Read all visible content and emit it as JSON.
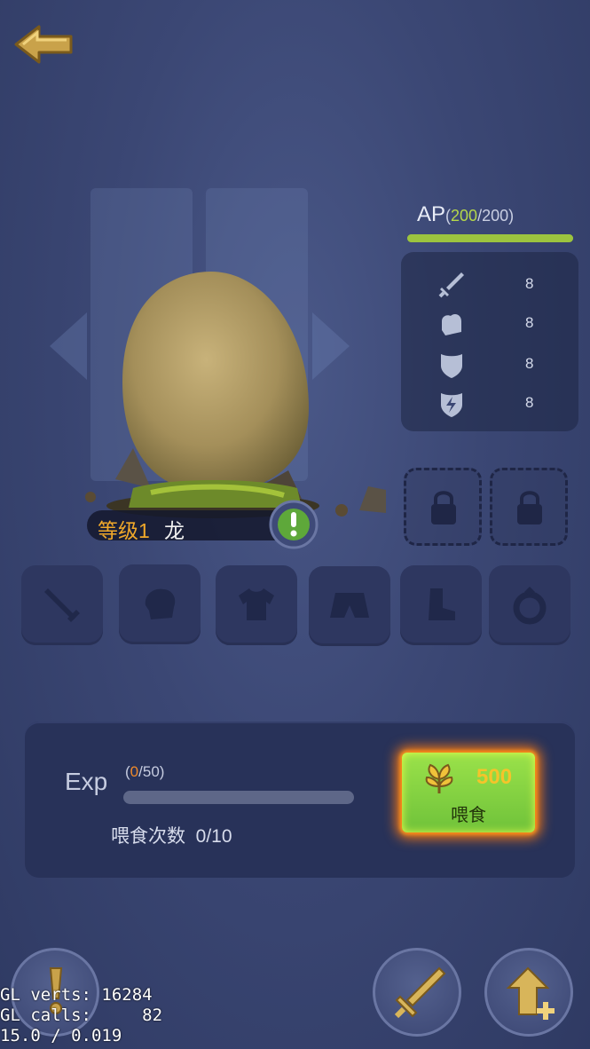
{
  "header": {
    "back_icon": "back-arrow-icon"
  },
  "ap": {
    "label": "AP",
    "open": "(",
    "current": "200",
    "sep": "/",
    "max": "200",
    "close": ")",
    "fill_fraction": 1.0
  },
  "stats": [
    {
      "icon": "sword-icon",
      "value": "8"
    },
    {
      "icon": "fist-icon",
      "value": "8"
    },
    {
      "icon": "shield-icon",
      "value": "8"
    },
    {
      "icon": "lightning-shield-icon",
      "value": "8"
    }
  ],
  "lock_slots": [
    {
      "icon": "lock-icon"
    },
    {
      "icon": "lock-icon"
    }
  ],
  "pet": {
    "level_text": "等级1",
    "name": "龙",
    "info_icon": "exclamation-icon"
  },
  "equipment_slots": [
    {
      "icon": "sword-icon"
    },
    {
      "icon": "glove-icon"
    },
    {
      "icon": "shirt-icon"
    },
    {
      "icon": "shorts-icon"
    },
    {
      "icon": "boot-icon"
    },
    {
      "icon": "ring-icon"
    }
  ],
  "exp": {
    "label": "Exp",
    "open": "(",
    "current": "0",
    "sep": "/",
    "max": "50",
    "close": ")",
    "fill_fraction": 0.0,
    "feed_count_label": "喂食次数",
    "feed_count_value": "0/10"
  },
  "feed_button": {
    "cost": "500",
    "label": "喂食",
    "icon": "leaf-icon"
  },
  "bottom_buttons": [
    {
      "icon": "exclamation-icon"
    },
    {
      "icon": "sword-icon"
    },
    {
      "icon": "upgrade-arrow-icon"
    }
  ],
  "debug": {
    "line1": "GL verts: 16284",
    "line2": "GL calls:     82",
    "line3": "15.0 / 0.019"
  },
  "colors": {
    "accent_green": "#b5d84a",
    "level_orange": "#f0a82a",
    "gold": "#c9a24a"
  }
}
